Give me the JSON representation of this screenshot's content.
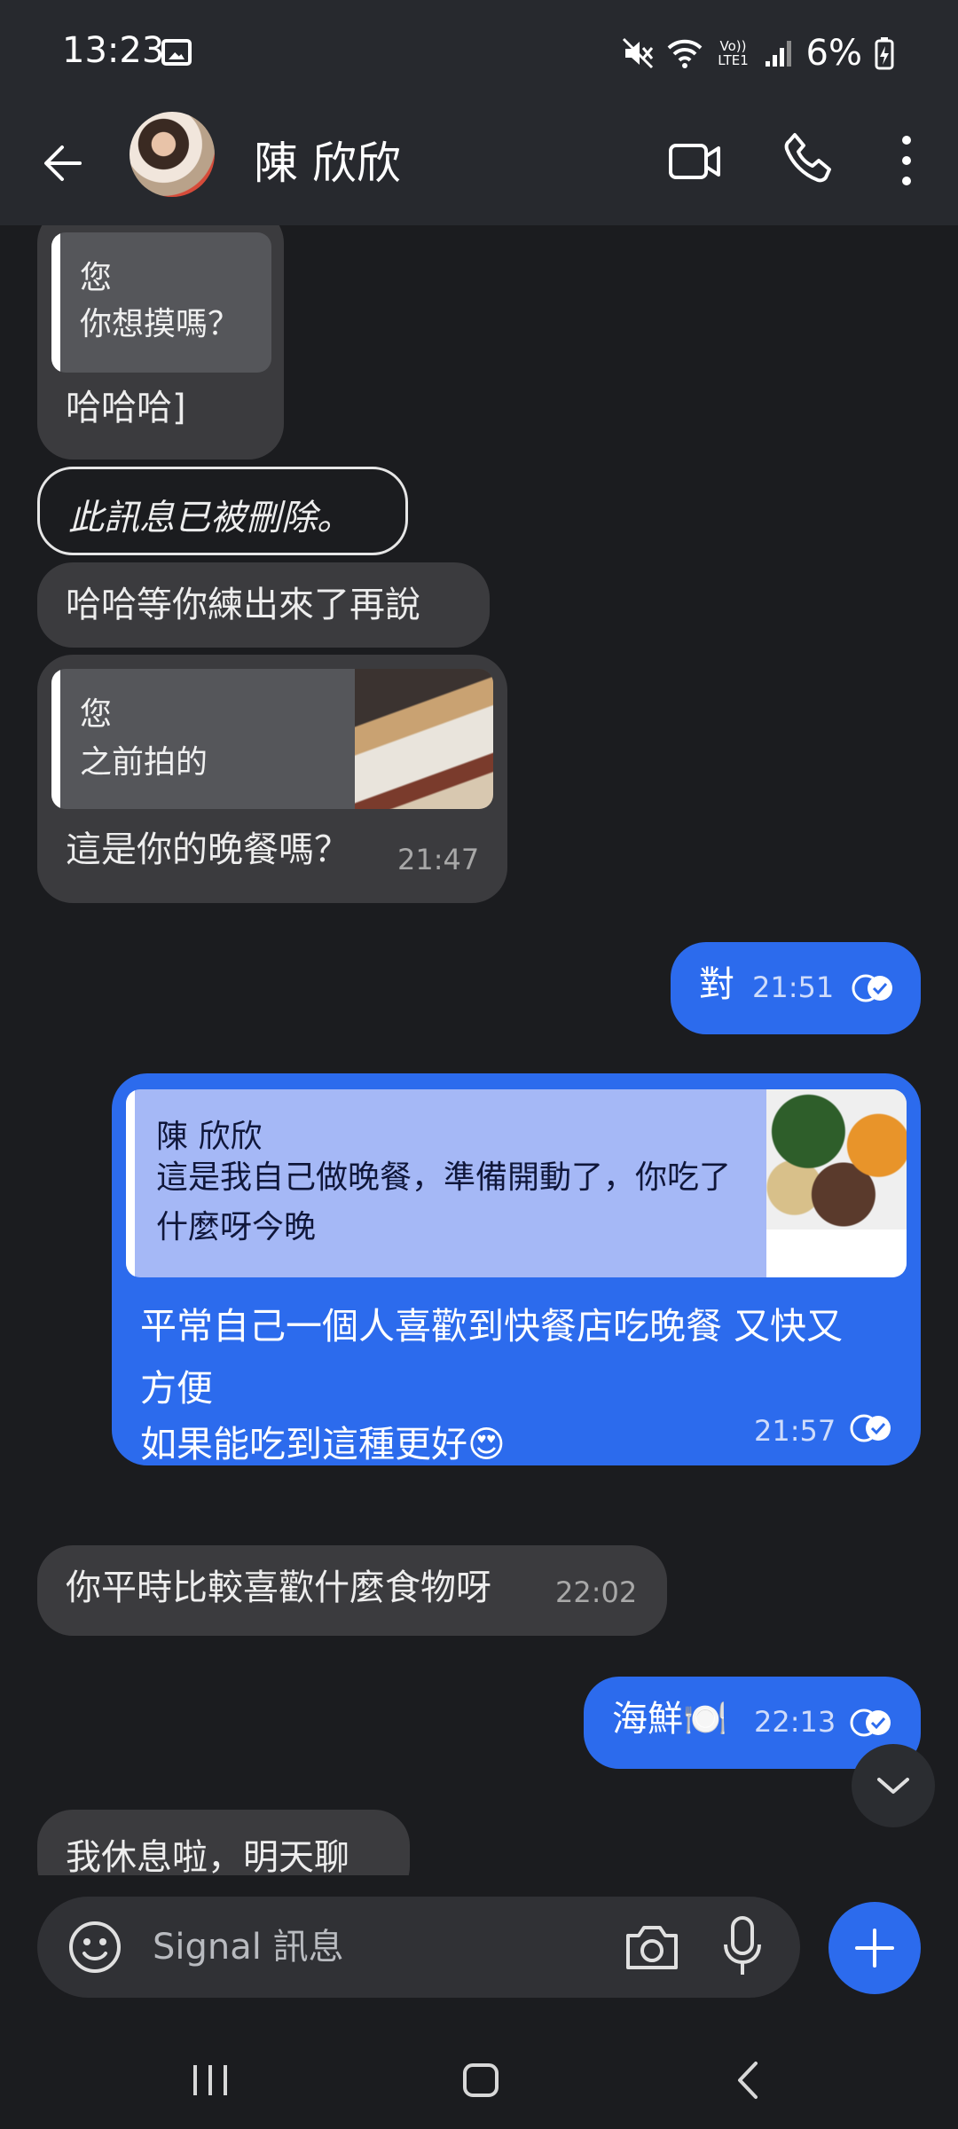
{
  "status_bar": {
    "time": "13:23",
    "battery": "6%",
    "network_label": "Vo)) LTE1"
  },
  "header": {
    "contact_name": "陳 欣欣"
  },
  "messages": {
    "m1": {
      "quote_author": "您",
      "quote_text": "你想摸嗎？",
      "text": "哈哈哈]"
    },
    "m2": {
      "text": "此訊息已被刪除。"
    },
    "m3": {
      "text": "哈哈等你練出來了再說"
    },
    "m4": {
      "quote_author": "您",
      "quote_text": "之前拍的",
      "text": "這是你的晚餐嗎？",
      "time": "21:47"
    },
    "m5": {
      "text": "對",
      "time": "21:51"
    },
    "m6": {
      "quote_author": "陳 欣欣",
      "quote_text": "這是我自己做晚餐，準備開動了，你吃了什麼呀今晚",
      "text_line1": "平常自己一個人喜歡到快餐店吃晚餐 又快又方便",
      "text_line2": "如果能吃到這種更好😍",
      "time": "21:57"
    },
    "m7": {
      "text": "你平時比較喜歡什麼食物呀",
      "time": "22:02"
    },
    "m8": {
      "text": "海鮮🍽️",
      "time": "22:13"
    },
    "m9": {
      "text": "我休息啦，明天聊"
    }
  },
  "compose": {
    "placeholder": "Signal 訊息"
  },
  "colors": {
    "outgoing": "#2c6bed",
    "incoming": "#3b3b3e",
    "background": "#1b1c1f"
  }
}
